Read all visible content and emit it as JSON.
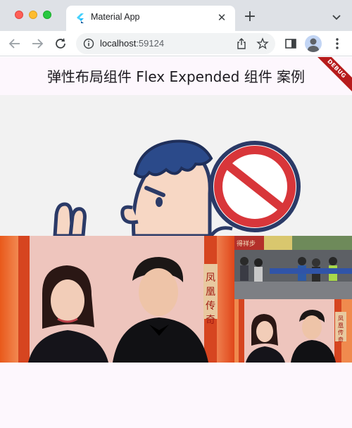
{
  "browser": {
    "tab": {
      "title": "Material App",
      "favicon": "flutter-icon"
    },
    "new_tab_label": "+",
    "close_tab_label": "✕",
    "address": {
      "host": "localhost",
      "port": ":59124"
    },
    "icons": [
      "back-icon",
      "forward-icon",
      "reload-icon",
      "info-icon",
      "share-icon",
      "star-icon",
      "side-panel-icon",
      "profile-icon",
      "menu-icon",
      "tab-search-icon"
    ]
  },
  "app": {
    "title": "弹性布局组件 Flex Expended 组件 案例",
    "debug_banner": "DEBUG",
    "background": "#fdf7fd",
    "images": [
      {
        "name": "cartoon-stop-sign-image",
        "description_icon": "cartoon-man-with-prohibition-sign"
      },
      {
        "name": "couple-stage-image",
        "stage_text": "凤凰传奇"
      },
      {
        "name": "crowd-street-image",
        "sign_text": "得祥步"
      },
      {
        "name": "couple-stage-small-image",
        "stage_text": "凤凰传奇"
      }
    ]
  }
}
